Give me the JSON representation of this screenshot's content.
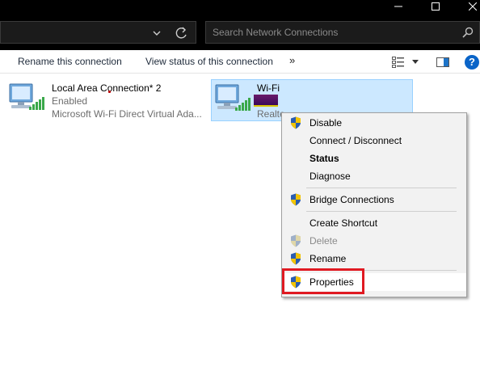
{
  "window": {
    "controls": [
      "minimize",
      "maximize",
      "close"
    ]
  },
  "address_bar": {
    "icons": [
      "chevron-down-icon",
      "refresh-icon"
    ]
  },
  "search": {
    "placeholder": "Search Network Connections",
    "icon": "search-icon"
  },
  "command_bar": {
    "rename": "Rename this connection",
    "view_status": "View status of this connection",
    "more": "»",
    "help": "?"
  },
  "connections": [
    {
      "name": "Local Area Connection* 2",
      "status": "Enabled",
      "device": "Microsoft Wi-Fi Direct Virtual Ada..."
    },
    {
      "name": "Wi-Fi",
      "status": "",
      "device": "Realte"
    }
  ],
  "context_menu": {
    "items": [
      {
        "label": "Disable",
        "shield": true
      },
      {
        "label": "Connect / Disconnect",
        "shield": false
      },
      {
        "label": "Status",
        "shield": false,
        "bold": true
      },
      {
        "label": "Diagnose",
        "shield": false
      },
      {
        "label": "Bridge Connections",
        "shield": true
      },
      {
        "label": "Create Shortcut",
        "shield": false
      },
      {
        "label": "Delete",
        "shield": true,
        "disabled": true
      },
      {
        "label": "Rename",
        "shield": true
      },
      {
        "label": "Properties",
        "shield": true,
        "highlighted": true
      }
    ]
  },
  "colors": {
    "selection_bg": "#cce8ff",
    "selection_border": "#99d1ff",
    "highlight_box": "#e01a22",
    "accent_blue": "#0a64c8"
  }
}
